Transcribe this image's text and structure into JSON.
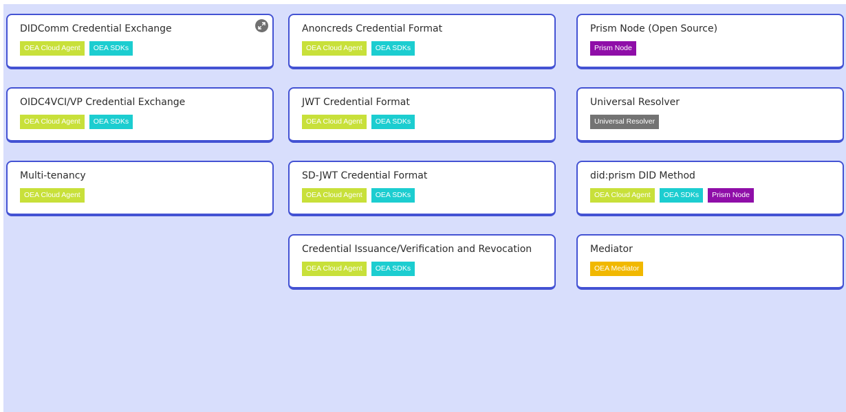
{
  "colors": {
    "board_bg": "#d8defc",
    "card_border": "#4352d3",
    "tag_oea_cloud_agent": "#c8e03a",
    "tag_oea_sdks": "#1ccdd0",
    "tag_prism_node": "#8f0ea8",
    "tag_universal_resolver": "#737373",
    "tag_oea_mediator": "#f1b800"
  },
  "tags": {
    "cloud": "OEA Cloud Agent",
    "sdk": "OEA SDKs",
    "prism": "Prism Node",
    "resolver": "Universal Resolver",
    "mediator": "OEA Mediator"
  },
  "columns": [
    {
      "cards": [
        {
          "title": "DIDComm Credential Exchange",
          "tags": [
            "OEA Cloud Agent",
            "OEA SDKs"
          ],
          "expand_icon": "expand-arrows-icon"
        },
        {
          "title": "OIDC4VCI/VP Credential Exchange",
          "tags": [
            "OEA Cloud Agent",
            "OEA SDKs"
          ]
        },
        {
          "title": "Multi-tenancy",
          "tags": [
            "OEA Cloud Agent"
          ]
        }
      ]
    },
    {
      "cards": [
        {
          "title": "Anoncreds Credential Format",
          "tags": [
            "OEA Cloud Agent",
            "OEA SDKs"
          ]
        },
        {
          "title": "JWT Credential Format",
          "tags": [
            "OEA Cloud Agent",
            "OEA SDKs"
          ]
        },
        {
          "title": "SD-JWT Credential Format",
          "tags": [
            "OEA Cloud Agent",
            "OEA SDKs"
          ]
        },
        {
          "title": "Credential Issuance/Verification and Revocation",
          "tags": [
            "OEA Cloud Agent",
            "OEA SDKs"
          ]
        }
      ]
    },
    {
      "cards": [
        {
          "title": "Prism Node (Open Source)",
          "tags": [
            "Prism Node"
          ]
        },
        {
          "title": "Universal Resolver",
          "tags": [
            "Universal Resolver"
          ]
        },
        {
          "title": "did:prism DID Method",
          "tags": [
            "OEA Cloud Agent",
            "OEA SDKs",
            "Prism Node"
          ]
        },
        {
          "title": "Mediator",
          "tags": [
            "OEA Mediator"
          ]
        }
      ]
    }
  ]
}
